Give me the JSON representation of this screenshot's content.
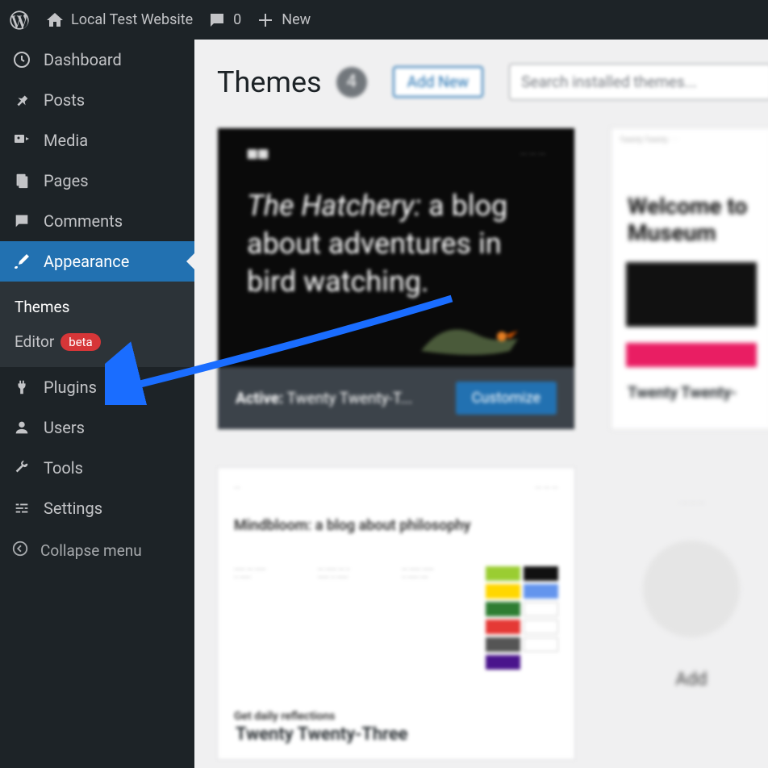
{
  "topbar": {
    "site_name": "Local Test Website",
    "comment_count": "0",
    "new_label": "New"
  },
  "sidebar": {
    "dashboard": "Dashboard",
    "posts": "Posts",
    "media": "Media",
    "pages": "Pages",
    "comments": "Comments",
    "appearance": "Appearance",
    "themes": "Themes",
    "editor": "Editor",
    "editor_badge": "beta",
    "plugins": "Plugins",
    "users": "Users",
    "tools": "Tools",
    "settings": "Settings",
    "collapse": "Collapse menu"
  },
  "main": {
    "title": "Themes",
    "theme_count": "4",
    "add_new": "Add New",
    "search_placeholder": "Search installed themes...",
    "active_theme": {
      "preview_heading_italic": "The Hatchery:",
      "preview_heading_rest": " a blog about adventures in bird watching.",
      "status_label": "Active:",
      "theme_name": "Twenty Twenty-T...",
      "customize": "Customize"
    },
    "theme2": {
      "welcome": "Welcome to Museum",
      "name": "Twenty Twenty-"
    },
    "theme3": {
      "preview_title": "Mindbloom: a blog about philosophy",
      "get_daily": "Get daily reflections",
      "name": "Twenty Twenty-Three"
    },
    "theme4": {
      "add_label": "Add"
    }
  }
}
